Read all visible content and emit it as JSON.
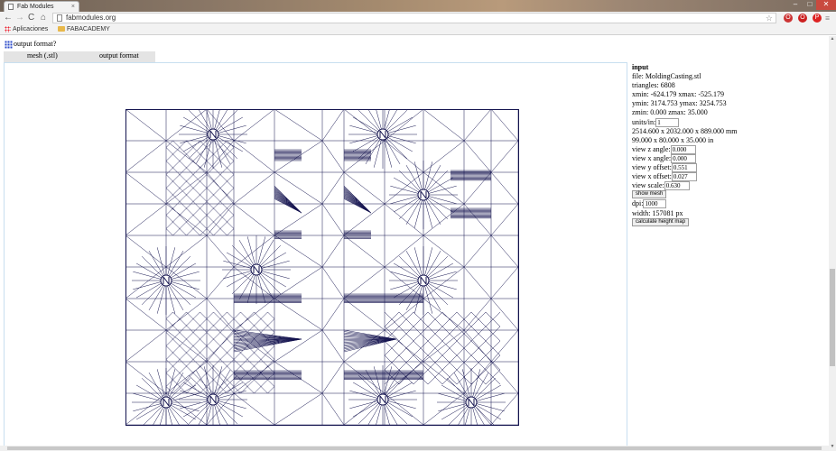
{
  "browser": {
    "tab_title": "Fab Modules",
    "tab_close": "×",
    "url": "fabmodules.org",
    "window_controls": {
      "minimize": "–",
      "maximize": "□",
      "close": "✕"
    },
    "nav": {
      "back": "←",
      "forward": "→",
      "reload": "C",
      "home": "⌂"
    },
    "star_icon": "☆",
    "extensions": [
      "O",
      "O",
      "P"
    ],
    "menu_icon": "≡",
    "bookmarks": [
      {
        "label": "Aplicaciones",
        "icon": "apps-grid-icon"
      },
      {
        "label": "FABACADEMY",
        "icon": "folder-icon"
      }
    ]
  },
  "page": {
    "format_question": "output format?",
    "tabs": [
      {
        "label": "mesh (.stl)"
      },
      {
        "label": "output format"
      }
    ],
    "info": {
      "heading": "input",
      "file": "file: MoldingCasting.stl",
      "triangles": "triangles: 6808",
      "xrange": "xmin: -624.179 xmax: -525.179",
      "yrange": "ymin: 3174.753 ymax: 3254.753",
      "zrange": "zmin: 0.000 zmax: 35.000",
      "units_label": "units/in:",
      "units_value": "1",
      "size_mm": "2514.600 x 2032.000 x 889.000 mm",
      "size_in": "99.000 x 80.000 x 35.000 in",
      "view_z_label": "view z angle:",
      "view_z_value": "0.000",
      "view_x_label": "view x angle:",
      "view_x_value": "0.000",
      "view_y_offset_label": "view y offset:",
      "view_y_offset_value": "0.551",
      "view_x_offset_label": "view x offset:",
      "view_x_offset_value": "0.027",
      "view_scale_label": "view scale:",
      "view_scale_value": "0.630",
      "show_mesh_button": "show mesh",
      "dpi_label": "dpi:",
      "dpi_value": "1000",
      "width_text": "width: 157081 px",
      "calc_button": "calculate height map"
    }
  },
  "colors": {
    "mesh_stroke": "#13124e",
    "panel_border": "#c8dff0",
    "tab_bg": "#e4e4e4"
  }
}
